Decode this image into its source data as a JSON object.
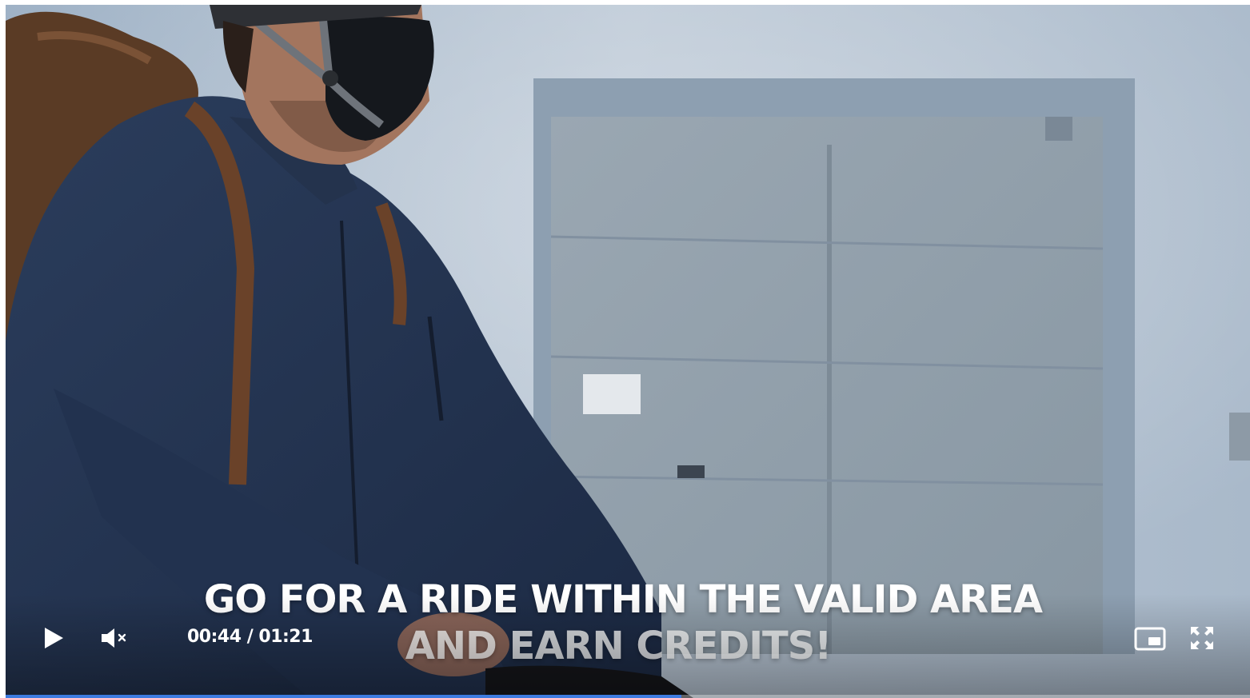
{
  "video": {
    "subtitle_line1": "GO FOR A RIDE WITHIN THE VALID AREA",
    "subtitle_line2": "AND EARN CREDITS!"
  },
  "controls": {
    "play_icon": "play-icon",
    "mute_icon": "volume-muted-icon",
    "time_display": "00:44 / 01:21",
    "pip_icon": "picture-in-picture-icon",
    "fullscreen_icon": "fullscreen-icon",
    "progress": 0.543
  },
  "colors": {
    "progress_fill": "#3d7be0",
    "control_icons": "#ffffff"
  }
}
